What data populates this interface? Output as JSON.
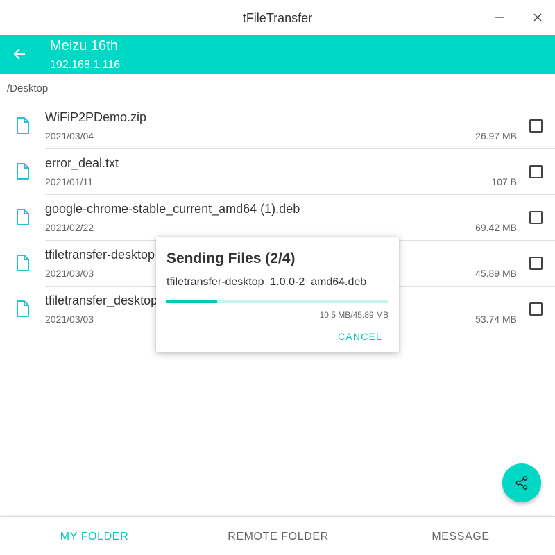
{
  "window": {
    "title": "tFileTransfer",
    "icons": {
      "minimize": "minimize-icon",
      "close": "close-icon"
    }
  },
  "header": {
    "back_icon": "arrow-back-icon",
    "device_name": "Meizu 16th",
    "device_ip": "192.168.1.116"
  },
  "path": "/Desktop",
  "files": [
    {
      "name": "WiFiP2PDemo.zip",
      "date": "2021/03/04",
      "size": "26.97 MB",
      "icon": "file-icon",
      "checked": false
    },
    {
      "name": "error_deal.txt",
      "date": "2021/01/11",
      "size": "107 B",
      "icon": "file-icon",
      "checked": false
    },
    {
      "name": "google-chrome-stable_current_amd64 (1).deb",
      "date": "2021/02/22",
      "size": "69.42 MB",
      "icon": "file-icon",
      "checked": false
    },
    {
      "name": "tfiletransfer-desktop",
      "date": "2021/03/03",
      "size": "45.89 MB",
      "icon": "file-icon",
      "checked": false
    },
    {
      "name": "tfiletransfer_desktop",
      "date": "2021/03/03",
      "size": "53.74 MB",
      "icon": "file-icon",
      "checked": false
    }
  ],
  "dialog": {
    "title": "Sending Files (2/4)",
    "file": "tfiletransfer-desktop_1.0.0-2_amd64.deb",
    "progress_text": "10.5 MB/45.89 MB",
    "progress_fraction": 0.229,
    "cancel": "CANCEL"
  },
  "fab": {
    "icon": "share-icon"
  },
  "nav": [
    {
      "label": "MY FOLDER",
      "active": true
    },
    {
      "label": "REMOTE FOLDER",
      "active": false
    },
    {
      "label": "MESSAGE",
      "active": false
    }
  ],
  "colors": {
    "accent": "#00d8c6",
    "accent_text": "#00c9b8",
    "file_icon": "#1ec4d6"
  }
}
